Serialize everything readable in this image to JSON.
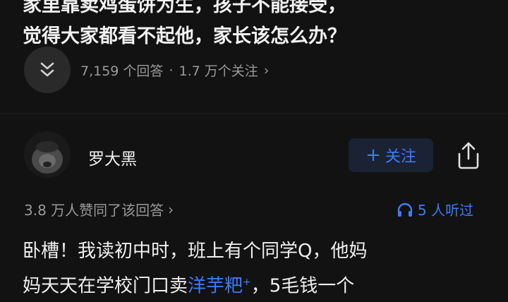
{
  "question": {
    "title_line1": "家里靠卖鸡蛋饼为生，孩子不能接受，",
    "title_line2": "觉得大家都看不起他，家长该怎么办？",
    "answers": "7,159 个回答",
    "dot": "·",
    "followers": "1.7 万个关注",
    "chevron": "›"
  },
  "author": {
    "name": "罗大黑",
    "follow_plus": "+",
    "follow_label": "关注"
  },
  "answer_meta": {
    "upvotes": "3.8 万人赞同了该回答",
    "chevron": "›",
    "listeners": "5 人听过"
  },
  "answer": {
    "line1": "卧槽！我读初中时，班上有个同学Q，他妈",
    "line2_before": "妈天天在学校门口卖",
    "keyword": "洋芋粑",
    "keyword_mark": "+",
    "line2_after": "，5毛钱一个"
  },
  "colors": {
    "background": "#121212",
    "accent_blue": "#3d7cf5",
    "muted_text": "#9a9a9a"
  }
}
